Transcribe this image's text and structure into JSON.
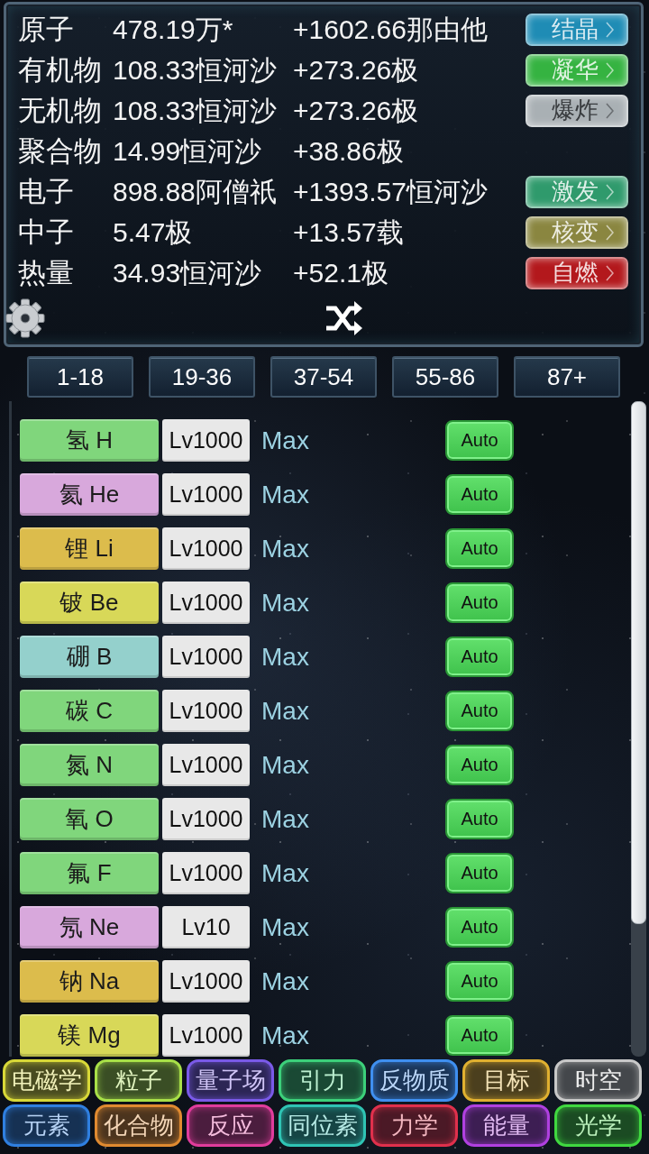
{
  "resources": [
    {
      "label": "原子",
      "value": "478.19万*",
      "rate": "+1602.66那由他",
      "action": {
        "label": "结晶",
        "color": "#1f8cb5"
      }
    },
    {
      "label": "有机物",
      "value": "108.33恒河沙",
      "rate": "+273.26极",
      "action": {
        "label": "凝华",
        "color": "#35b341"
      }
    },
    {
      "label": "无机物",
      "value": "108.33恒河沙",
      "rate": "+273.26极",
      "action": {
        "label": "爆炸",
        "color": "#a9b0b4"
      }
    },
    {
      "label": "聚合物",
      "value": "14.99恒河沙",
      "rate": "+38.86极"
    },
    {
      "label": "电子",
      "value": "898.88阿僧祇",
      "rate": "+1393.57恒河沙",
      "action": {
        "label": "激发",
        "color": "#2f9a6c"
      }
    },
    {
      "label": "中子",
      "value": "5.47极",
      "rate": "+13.57载",
      "action": {
        "label": "核变",
        "color": "#8a8640"
      }
    },
    {
      "label": "热量",
      "value": "34.93恒河沙",
      "rate": "+52.1极",
      "action": {
        "label": "自燃",
        "color": "#b3181c"
      }
    }
  ],
  "range_tabs": [
    "1-18",
    "19-36",
    "37-54",
    "55-86",
    "87+"
  ],
  "elements": [
    {
      "name": "氢 H",
      "color": "#80d67c",
      "level": "Lv1000",
      "status": "Max",
      "auto": "Auto"
    },
    {
      "name": "氦 He",
      "color": "#d8a8dc",
      "level": "Lv1000",
      "status": "Max",
      "auto": "Auto"
    },
    {
      "name": "锂 Li",
      "color": "#dcbc4c",
      "level": "Lv1000",
      "status": "Max",
      "auto": "Auto"
    },
    {
      "name": "铍 Be",
      "color": "#d8d858",
      "level": "Lv1000",
      "status": "Max",
      "auto": "Auto"
    },
    {
      "name": "硼 B",
      "color": "#94d0cc",
      "level": "Lv1000",
      "status": "Max",
      "auto": "Auto"
    },
    {
      "name": "碳 C",
      "color": "#80d67c",
      "level": "Lv1000",
      "status": "Max",
      "auto": "Auto"
    },
    {
      "name": "氮 N",
      "color": "#80d67c",
      "level": "Lv1000",
      "status": "Max",
      "auto": "Auto"
    },
    {
      "name": "氧 O",
      "color": "#80d67c",
      "level": "Lv1000",
      "status": "Max",
      "auto": "Auto"
    },
    {
      "name": "氟 F",
      "color": "#80d67c",
      "level": "Lv1000",
      "status": "Max",
      "auto": "Auto"
    },
    {
      "name": "氖 Ne",
      "color": "#d8a8dc",
      "level": "Lv10",
      "status": "Max",
      "auto": "Auto"
    },
    {
      "name": "钠 Na",
      "color": "#dcbc4c",
      "level": "Lv1000",
      "status": "Max",
      "auto": "Auto"
    },
    {
      "name": "镁 Mg",
      "color": "#d8d858",
      "level": "Lv1000",
      "status": "Max",
      "auto": "Auto"
    }
  ],
  "nav": [
    {
      "items": [
        {
          "label": "电磁学",
          "color": "#d8d838"
        },
        {
          "label": "粒子",
          "color": "#a8e048"
        },
        {
          "label": "量子场",
          "color": "#7a5ae8"
        },
        {
          "label": "引力",
          "color": "#3cd07a"
        },
        {
          "label": "反物质",
          "color": "#3f8ff0"
        },
        {
          "label": "目标",
          "color": "#e0b030"
        },
        {
          "label": "时空",
          "color": "#c8c8c8"
        }
      ]
    },
    {
      "items": [
        {
          "label": "元素",
          "color": "#2f7fe0"
        },
        {
          "label": "化合物",
          "color": "#e08a30"
        },
        {
          "label": "反应",
          "color": "#e03c9c"
        },
        {
          "label": "同位素",
          "color": "#2fc4b4"
        },
        {
          "label": "力学",
          "color": "#e0304c"
        },
        {
          "label": "能量",
          "color": "#b040e0"
        },
        {
          "label": "光学",
          "color": "#40d840"
        }
      ]
    }
  ]
}
